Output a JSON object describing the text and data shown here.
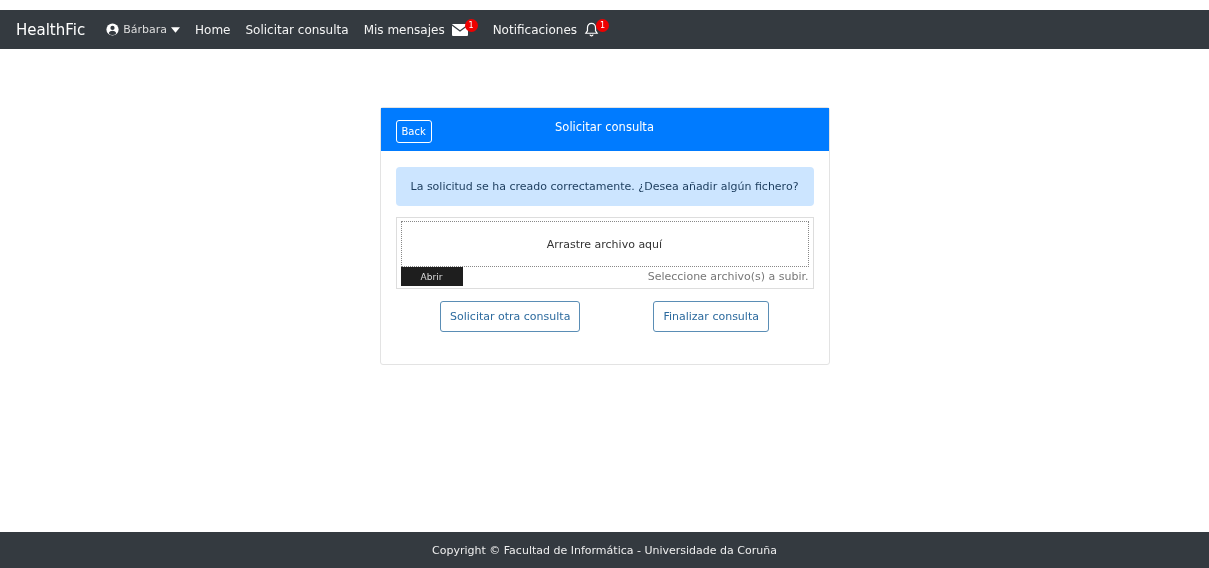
{
  "navbar": {
    "brand": "HealthFic",
    "items": [
      {
        "kind": "user",
        "label": "Bárbara"
      },
      {
        "kind": "link",
        "label": "Home"
      },
      {
        "kind": "link",
        "label": "Solicitar consulta"
      },
      {
        "kind": "messages",
        "label": "Mis mensajes",
        "badge": "1"
      },
      {
        "kind": "notifications",
        "label": "Notificaciones",
        "badge": "1"
      }
    ]
  },
  "card": {
    "back_button": "Back",
    "title": "Solicitar consulta",
    "alert": "La solicitud se ha creado correctamente. ¿Desea añadir algún fichero?",
    "upload": {
      "drop_text": "Arrastre archivo aquí",
      "open_button": "Abrir",
      "status": "Seleccione archivo(s) a subir."
    },
    "buttons": [
      "Solicitar otra consulta",
      "Finalizar consulta"
    ]
  },
  "footer": "Copyright © Facultad de Informática - Universidade da Coruña"
}
